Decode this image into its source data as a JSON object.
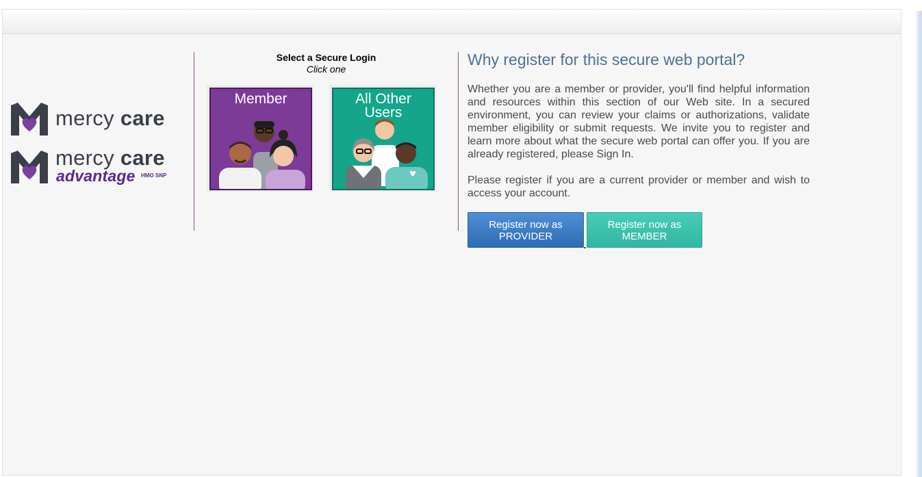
{
  "logos": {
    "mercy_care": {
      "text_light": "mercy ",
      "text_bold": "care"
    },
    "mercy_care_advantage": {
      "text_light": "mercy ",
      "text_bold": "care",
      "sub": "advantage",
      "sup": "HMO SNP"
    }
  },
  "login": {
    "title": "Select a Secure Login",
    "subtitle": "Click one",
    "tiles": [
      {
        "label": "Member",
        "color": "#7b3b97"
      },
      {
        "label_line1": "All Other",
        "label_line2": "Users",
        "color": "#14a58a"
      }
    ]
  },
  "info": {
    "title": "Why register for this secure web portal?",
    "paragraph1": "Whether you are a member or provider, you'll find helpful information and resources within this section of our Web site. In a secured environment, you can review your claims or authorizations, validate member eligibility or submit requests. We invite you to register and learn more about what the secure web portal can offer you. If you are already registered, please Sign In.",
    "paragraph2": "Please register if you are a current provider or member and wish to access your account."
  },
  "buttons": {
    "provider_line1": "Register now as",
    "provider_line2": "PROVIDER",
    "member_line1": "Register now as",
    "member_line2": "MEMBER"
  },
  "colors": {
    "brand_purple": "#5a2a8c",
    "title_blue": "#4f7197",
    "provider_button": "#3a7cc4",
    "member_button": "#3cc2ad"
  }
}
